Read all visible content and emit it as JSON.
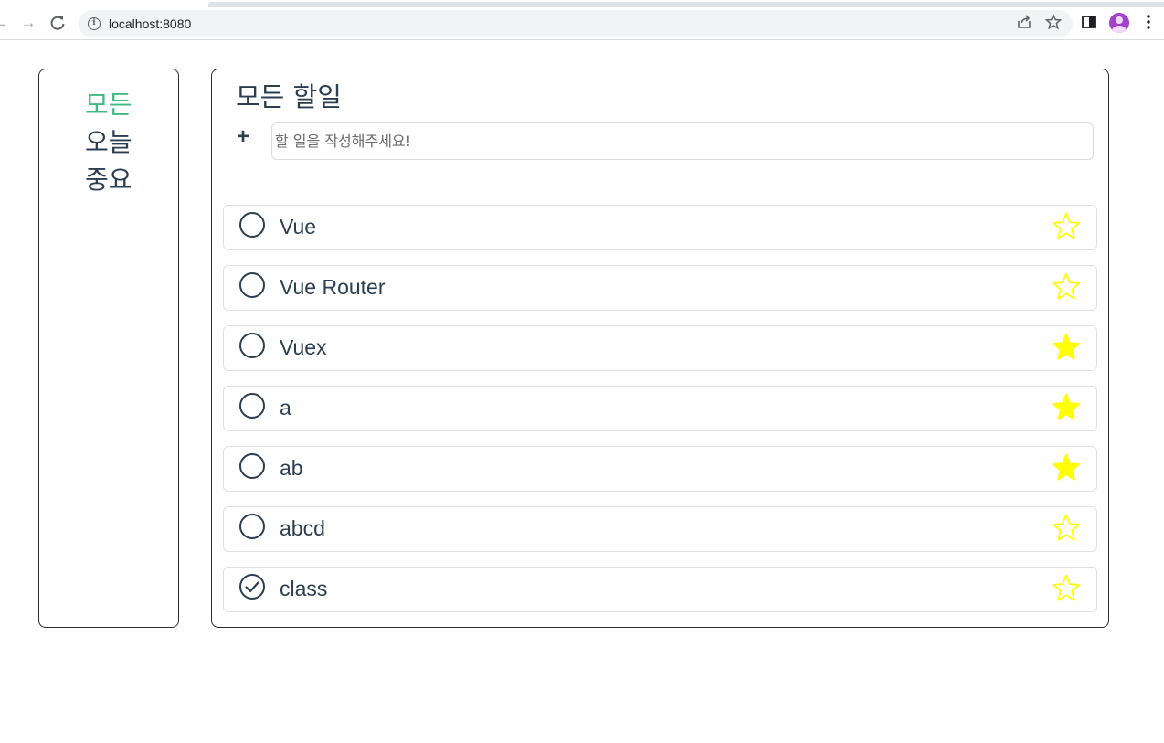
{
  "browser": {
    "url": "localhost:8080"
  },
  "sidebar": {
    "items": [
      {
        "label": "모든",
        "active": true
      },
      {
        "label": "오늘",
        "active": false
      },
      {
        "label": "중요",
        "active": false
      }
    ],
    "active_color": "#42b983"
  },
  "main": {
    "title": "모든 할일",
    "add_label": "+",
    "input_placeholder": "할 일을 작성해주세요!",
    "input_value": ""
  },
  "todos": [
    {
      "text": "Vue",
      "done": false,
      "important": false
    },
    {
      "text": "Vue Router",
      "done": false,
      "important": false
    },
    {
      "text": "Vuex",
      "done": false,
      "important": true
    },
    {
      "text": "a",
      "done": false,
      "important": true
    },
    {
      "text": "ab",
      "done": false,
      "important": true
    },
    {
      "text": "abcd",
      "done": false,
      "important": false
    },
    {
      "text": "class",
      "done": true,
      "important": false
    }
  ],
  "colors": {
    "star": "#ffff00",
    "text": "#2c3e50"
  }
}
